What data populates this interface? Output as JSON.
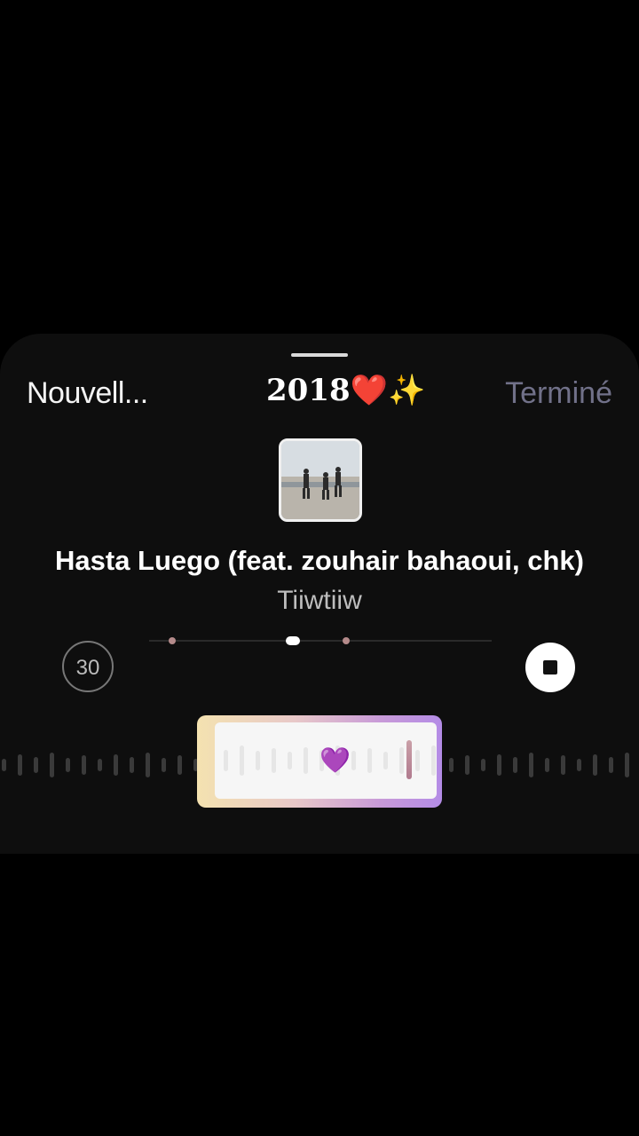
{
  "header": {
    "left_label": "Nouvell...",
    "title": "2018❤️✨",
    "done_label": "Terminé"
  },
  "track": {
    "title": "Hasta Luego (feat. zouhair bahaoui, chk)",
    "artist": "Tiiwtiiw"
  },
  "controls": {
    "duration_label": "30",
    "progress": 0.42
  },
  "selection": {
    "marker_icon": "💜"
  },
  "colors": {
    "done_inactive": "#717189",
    "sheet_bg": "#0e0e0e"
  }
}
